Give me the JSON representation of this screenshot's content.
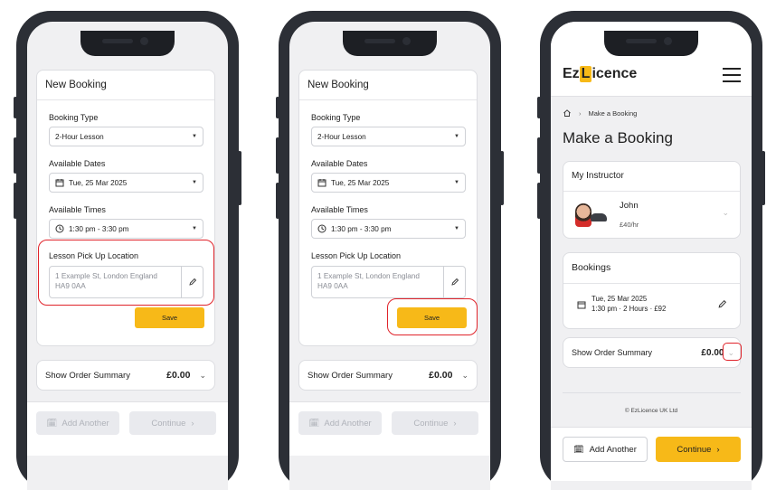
{
  "colors": {
    "accent": "#f7b918",
    "highlight": "#e0232a"
  },
  "form": {
    "title": "New Booking",
    "booking_type_label": "Booking Type",
    "booking_type_value": "2-Hour Lesson",
    "dates_label": "Available Dates",
    "dates_value": "Tue, 25 Mar 2025",
    "times_label": "Available Times",
    "times_value": "1:30 pm - 3:30 pm",
    "location_label": "Lesson Pick Up Location",
    "location_line1": "1 Example St, London England",
    "location_line2": "HA9 0AA",
    "save_label": "Save"
  },
  "summary": {
    "label": "Show Order Summary",
    "amount": "£0.00"
  },
  "footer": {
    "add_another": "Add Another",
    "continue": "Continue"
  },
  "screen3": {
    "brand_pre": "Ez",
    "brand_letter": "L",
    "brand_post": "icence",
    "breadcrumb": "Make a Booking",
    "title": "Make a Booking",
    "instructor_header": "My Instructor",
    "instructor_name": "John",
    "instructor_rate": "£40/hr",
    "bookings_header": "Bookings",
    "booking_date": "Tue, 25 Mar 2025",
    "booking_detail": "1:30 pm · 2 Hours · £92",
    "copyright": "© EzLicence UK Ltd"
  }
}
